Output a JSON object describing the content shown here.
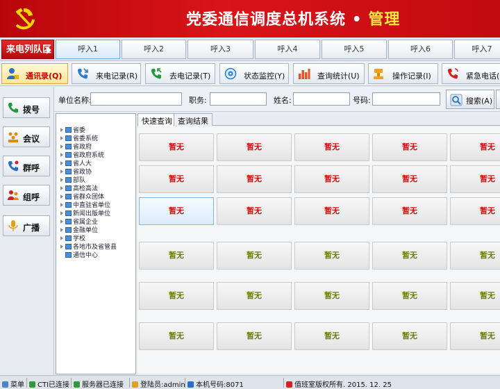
{
  "header": {
    "title_main": "党委通信调度总机系统",
    "title_dot": " • ",
    "title_admin": "管理",
    "colors": {
      "bar": "#c10b10",
      "admin_text": "#ffe640"
    }
  },
  "queue": {
    "label": "来电列队区",
    "slots": [
      "呼入1",
      "呼入2",
      "呼入3",
      "呼入4",
      "呼入5",
      "呼入6",
      "呼入7"
    ]
  },
  "toolbar": {
    "items": [
      {
        "label": "通讯录(Q)",
        "icon": "user-icon"
      },
      {
        "label": "来电记录(R)",
        "icon": "incoming-call-icon"
      },
      {
        "label": "去电记录(T)",
        "icon": "outgoing-call-icon"
      },
      {
        "label": "状态监控(Y)",
        "icon": "monitor-icon"
      },
      {
        "label": "查询统计(U)",
        "icon": "bar-chart-icon"
      },
      {
        "label": "操作记录(I)",
        "icon": "stamp-icon"
      },
      {
        "label": "紧急电话(O)",
        "icon": "emergency-phone-icon"
      }
    ]
  },
  "sidebar": {
    "items": [
      {
        "label": "拨号",
        "icon": "dial-phone-icon"
      },
      {
        "label": "会议",
        "icon": "conference-icon"
      },
      {
        "label": "群呼",
        "icon": "group-call-icon"
      },
      {
        "label": "组呼",
        "icon": "group-user-icon"
      },
      {
        "label": "广播",
        "icon": "microphone-icon"
      }
    ]
  },
  "search": {
    "unit_label": "单位名称:",
    "unit_value": "",
    "position_label": "职务:",
    "position_value": "",
    "name_label": "姓名:",
    "name_value": "",
    "number_label": "号码:",
    "number_value": "",
    "search_button": "搜索(A)"
  },
  "tree": {
    "items": [
      "省委",
      "省委系统",
      "省政府",
      "省政府系统",
      "省人大",
      "省政协",
      "部队",
      "高检高法",
      "省群众团体",
      "中直驻省单位",
      "新闻出版单位",
      "省属企业",
      "金融单位",
      "学校",
      "各地市及省管县",
      "通信中心"
    ]
  },
  "tabs": [
    "快速查询",
    "查询结果"
  ],
  "grid": {
    "cell_text": "暂无",
    "rows": [
      [
        "暂无",
        "暂无",
        "暂无",
        "暂无",
        "暂无"
      ],
      [
        "暂无",
        "暂无",
        "暂无",
        "暂无",
        "暂无"
      ],
      [
        "暂无",
        "暂无",
        "暂无",
        "暂无",
        "暂无"
      ],
      [
        "暂无",
        "暂无",
        "暂无",
        "暂无",
        "暂无"
      ],
      [
        "暂无",
        "暂无",
        "暂无",
        "暂无",
        "暂无"
      ],
      [
        "暂无",
        "暂无",
        "暂无",
        "暂无",
        "暂无"
      ]
    ]
  },
  "status": {
    "menu": "菜单",
    "cti": "CTI已连接",
    "server": "服务器已连接",
    "login": "登陆员:admin",
    "extension": "本机号码:8071",
    "copyright": "值班室版权所有. 2015. 12. 25"
  }
}
